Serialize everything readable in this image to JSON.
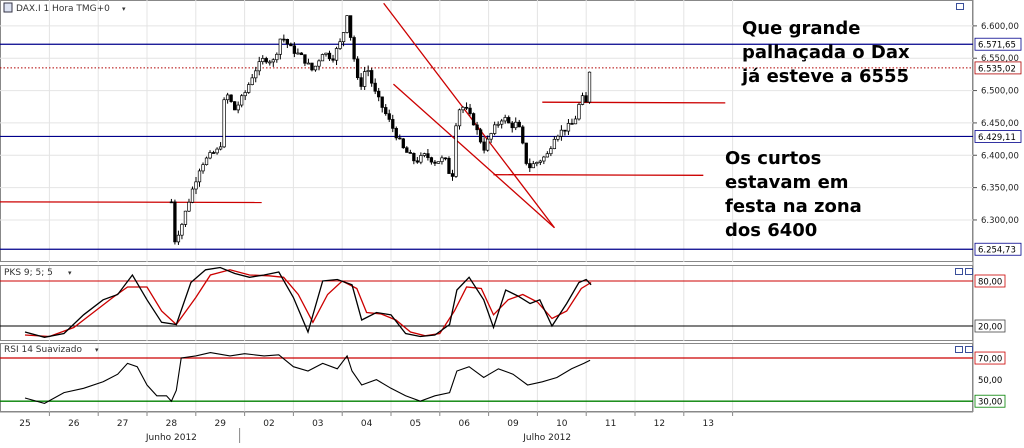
{
  "colors": {
    "price": "#000000",
    "level_blue": "#00008b",
    "trend_red": "#cc0000",
    "current_price": "#b00000",
    "pks_signal": "#cc0000",
    "rsi_high": "#cc0000",
    "rsi_low": "#008000",
    "grid": "#e4e4e4",
    "frame": "#888888"
  },
  "chart_data": [
    {
      "type": "candlestick",
      "title": "DAX.I 1 Hora TMG+0",
      "y_ticks": [
        "6.600,00",
        "6.550,00",
        "6.500,00",
        "6.450,00",
        "6.400,00",
        "6.350,00",
        "6.300,00"
      ],
      "ylim": [
        6235,
        6640
      ],
      "highlighted_levels": [
        "6.571,65",
        "6.535,02",
        "6.429,11",
        "6.254,73"
      ],
      "level_values": [
        6571.65,
        6535.02,
        6429.11,
        6254.73
      ],
      "current_price": 6535.02,
      "close_path": [
        {
          "x": 0.0,
          "y": 6328
        },
        {
          "x": 3.0,
          "y": 6328
        },
        {
          "x": 3.0,
          "y": 6275
        },
        {
          "x": 3.05,
          "y": 6265
        },
        {
          "x": 3.2,
          "y": 6290
        },
        {
          "x": 3.4,
          "y": 6340
        },
        {
          "x": 3.6,
          "y": 6385
        },
        {
          "x": 3.8,
          "y": 6400
        },
        {
          "x": 4.0,
          "y": 6410
        },
        {
          "x": 4.1,
          "y": 6500
        },
        {
          "x": 4.3,
          "y": 6470
        },
        {
          "x": 4.5,
          "y": 6495
        },
        {
          "x": 4.7,
          "y": 6530
        },
        {
          "x": 4.9,
          "y": 6550
        },
        {
          "x": 5.1,
          "y": 6545
        },
        {
          "x": 5.25,
          "y": 6585
        },
        {
          "x": 5.45,
          "y": 6565
        },
        {
          "x": 5.7,
          "y": 6550
        },
        {
          "x": 5.9,
          "y": 6530
        },
        {
          "x": 6.1,
          "y": 6560
        },
        {
          "x": 6.3,
          "y": 6550
        },
        {
          "x": 6.5,
          "y": 6580
        },
        {
          "x": 6.6,
          "y": 6620
        },
        {
          "x": 6.7,
          "y": 6570
        },
        {
          "x": 6.85,
          "y": 6500
        },
        {
          "x": 7.0,
          "y": 6540
        },
        {
          "x": 7.15,
          "y": 6500
        },
        {
          "x": 7.35,
          "y": 6470
        },
        {
          "x": 7.55,
          "y": 6440
        },
        {
          "x": 7.75,
          "y": 6410
        },
        {
          "x": 8.0,
          "y": 6390
        },
        {
          "x": 8.2,
          "y": 6400
        },
        {
          "x": 8.4,
          "y": 6390
        },
        {
          "x": 8.6,
          "y": 6395
        },
        {
          "x": 8.75,
          "y": 6360
        },
        {
          "x": 8.85,
          "y": 6470
        },
        {
          "x": 9.0,
          "y": 6475
        },
        {
          "x": 9.2,
          "y": 6450
        },
        {
          "x": 9.4,
          "y": 6410
        },
        {
          "x": 9.6,
          "y": 6440
        },
        {
          "x": 9.8,
          "y": 6460
        },
        {
          "x": 9.95,
          "y": 6445
        },
        {
          "x": 10.1,
          "y": 6450
        },
        {
          "x": 10.3,
          "y": 6380
        },
        {
          "x": 10.5,
          "y": 6390
        },
        {
          "x": 10.7,
          "y": 6400
        },
        {
          "x": 10.85,
          "y": 6430
        },
        {
          "x": 11.05,
          "y": 6440
        },
        {
          "x": 11.25,
          "y": 6450
        },
        {
          "x": 11.4,
          "y": 6490
        },
        {
          "x": 11.5,
          "y": 6480
        },
        {
          "x": 11.58,
          "y": 6540
        }
      ],
      "annotations": [
        "Que grande palhaçada o Dax já esteve a 6555",
        "Os curtos estavam em festa na zona dos 6400"
      ]
    },
    {
      "type": "line",
      "title": "PKS 9; 5; 5",
      "y_ticks": [
        "80,00",
        "20,00"
      ],
      "ylim": [
        0,
        100
      ],
      "reference_levels": [
        80,
        20
      ],
      "series_main": [
        {
          "x": 0.0,
          "y": 12
        },
        {
          "x": 0.4,
          "y": 5
        },
        {
          "x": 0.8,
          "y": 10
        },
        {
          "x": 1.2,
          "y": 35
        },
        {
          "x": 1.6,
          "y": 55
        },
        {
          "x": 1.9,
          "y": 62
        },
        {
          "x": 2.2,
          "y": 88
        },
        {
          "x": 2.5,
          "y": 55
        },
        {
          "x": 2.8,
          "y": 25
        },
        {
          "x": 3.1,
          "y": 22
        },
        {
          "x": 3.4,
          "y": 78
        },
        {
          "x": 3.7,
          "y": 95
        },
        {
          "x": 4.0,
          "y": 98
        },
        {
          "x": 4.3,
          "y": 90
        },
        {
          "x": 4.6,
          "y": 85
        },
        {
          "x": 4.9,
          "y": 88
        },
        {
          "x": 5.2,
          "y": 92
        },
        {
          "x": 5.5,
          "y": 58
        },
        {
          "x": 5.8,
          "y": 12
        },
        {
          "x": 6.1,
          "y": 80
        },
        {
          "x": 6.4,
          "y": 82
        },
        {
          "x": 6.7,
          "y": 75
        },
        {
          "x": 6.9,
          "y": 28
        },
        {
          "x": 7.2,
          "y": 38
        },
        {
          "x": 7.5,
          "y": 35
        },
        {
          "x": 7.8,
          "y": 10
        },
        {
          "x": 8.1,
          "y": 6
        },
        {
          "x": 8.4,
          "y": 8
        },
        {
          "x": 8.7,
          "y": 22
        },
        {
          "x": 8.85,
          "y": 68
        },
        {
          "x": 9.1,
          "y": 85
        },
        {
          "x": 9.4,
          "y": 55
        },
        {
          "x": 9.6,
          "y": 18
        },
        {
          "x": 9.85,
          "y": 68
        },
        {
          "x": 10.1,
          "y": 60
        },
        {
          "x": 10.35,
          "y": 50
        },
        {
          "x": 10.55,
          "y": 55
        },
        {
          "x": 10.8,
          "y": 20
        },
        {
          "x": 11.1,
          "y": 50
        },
        {
          "x": 11.35,
          "y": 78
        },
        {
          "x": 11.5,
          "y": 82
        },
        {
          "x": 11.6,
          "y": 75
        }
      ],
      "series_signal": [
        {
          "x": 0.0,
          "y": 8
        },
        {
          "x": 0.5,
          "y": 6
        },
        {
          "x": 1.0,
          "y": 18
        },
        {
          "x": 1.4,
          "y": 38
        },
        {
          "x": 1.8,
          "y": 58
        },
        {
          "x": 2.1,
          "y": 72
        },
        {
          "x": 2.5,
          "y": 72
        },
        {
          "x": 2.8,
          "y": 40
        },
        {
          "x": 3.1,
          "y": 22
        },
        {
          "x": 3.5,
          "y": 58
        },
        {
          "x": 3.8,
          "y": 88
        },
        {
          "x": 4.2,
          "y": 95
        },
        {
          "x": 4.6,
          "y": 88
        },
        {
          "x": 5.0,
          "y": 87
        },
        {
          "x": 5.3,
          "y": 85
        },
        {
          "x": 5.6,
          "y": 62
        },
        {
          "x": 5.9,
          "y": 25
        },
        {
          "x": 6.2,
          "y": 62
        },
        {
          "x": 6.5,
          "y": 80
        },
        {
          "x": 6.8,
          "y": 70
        },
        {
          "x": 7.0,
          "y": 38
        },
        {
          "x": 7.3,
          "y": 36
        },
        {
          "x": 7.6,
          "y": 28
        },
        {
          "x": 7.9,
          "y": 12
        },
        {
          "x": 8.2,
          "y": 7
        },
        {
          "x": 8.5,
          "y": 10
        },
        {
          "x": 8.8,
          "y": 40
        },
        {
          "x": 9.05,
          "y": 72
        },
        {
          "x": 9.35,
          "y": 70
        },
        {
          "x": 9.6,
          "y": 35
        },
        {
          "x": 9.9,
          "y": 55
        },
        {
          "x": 10.2,
          "y": 62
        },
        {
          "x": 10.5,
          "y": 52
        },
        {
          "x": 10.8,
          "y": 30
        },
        {
          "x": 11.1,
          "y": 40
        },
        {
          "x": 11.4,
          "y": 70
        },
        {
          "x": 11.6,
          "y": 78
        }
      ]
    },
    {
      "type": "line",
      "title": "RSI 14 Suavizado",
      "y_ticks": [
        "70,00",
        "50,00",
        "30,00"
      ],
      "ylim": [
        20,
        83
      ],
      "reference_levels": [
        70,
        30
      ],
      "series_main": [
        {
          "x": 0.0,
          "y": 33
        },
        {
          "x": 0.4,
          "y": 28
        },
        {
          "x": 0.8,
          "y": 38
        },
        {
          "x": 1.2,
          "y": 42
        },
        {
          "x": 1.6,
          "y": 48
        },
        {
          "x": 1.9,
          "y": 55
        },
        {
          "x": 2.1,
          "y": 65
        },
        {
          "x": 2.3,
          "y": 62
        },
        {
          "x": 2.5,
          "y": 45
        },
        {
          "x": 2.7,
          "y": 35
        },
        {
          "x": 2.9,
          "y": 35
        },
        {
          "x": 3.0,
          "y": 30
        },
        {
          "x": 3.1,
          "y": 40
        },
        {
          "x": 3.2,
          "y": 70
        },
        {
          "x": 3.5,
          "y": 72
        },
        {
          "x": 3.8,
          "y": 75
        },
        {
          "x": 4.2,
          "y": 72
        },
        {
          "x": 4.5,
          "y": 74
        },
        {
          "x": 4.9,
          "y": 72
        },
        {
          "x": 5.2,
          "y": 73
        },
        {
          "x": 5.5,
          "y": 62
        },
        {
          "x": 5.8,
          "y": 58
        },
        {
          "x": 6.1,
          "y": 65
        },
        {
          "x": 6.4,
          "y": 60
        },
        {
          "x": 6.6,
          "y": 72
        },
        {
          "x": 6.7,
          "y": 58
        },
        {
          "x": 6.9,
          "y": 45
        },
        {
          "x": 7.2,
          "y": 50
        },
        {
          "x": 7.5,
          "y": 42
        },
        {
          "x": 7.8,
          "y": 35
        },
        {
          "x": 8.1,
          "y": 30
        },
        {
          "x": 8.4,
          "y": 35
        },
        {
          "x": 8.7,
          "y": 38
        },
        {
          "x": 8.85,
          "y": 58
        },
        {
          "x": 9.1,
          "y": 62
        },
        {
          "x": 9.4,
          "y": 52
        },
        {
          "x": 9.7,
          "y": 60
        },
        {
          "x": 10.0,
          "y": 55
        },
        {
          "x": 10.3,
          "y": 45
        },
        {
          "x": 10.6,
          "y": 48
        },
        {
          "x": 10.9,
          "y": 52
        },
        {
          "x": 11.2,
          "y": 60
        },
        {
          "x": 11.45,
          "y": 65
        },
        {
          "x": 11.58,
          "y": 68
        }
      ]
    }
  ],
  "x_axis": {
    "day_labels": [
      "25",
      "26",
      "27",
      "28",
      "29",
      "02",
      "03",
      "04",
      "05",
      "06",
      "09",
      "10",
      "11",
      "12",
      "13"
    ],
    "month_labels": [
      {
        "text": "Junho 2012",
        "at": 3.0
      },
      {
        "text": "Julho 2012",
        "at": 10.7
      }
    ]
  },
  "annotation_top": [
    "Que grande",
    "palhaçada o Dax",
    "já esteve a 6555"
  ],
  "annotation_mid": [
    "Os curtos",
    "estavam em",
    "festa na zona",
    "dos 6400"
  ]
}
